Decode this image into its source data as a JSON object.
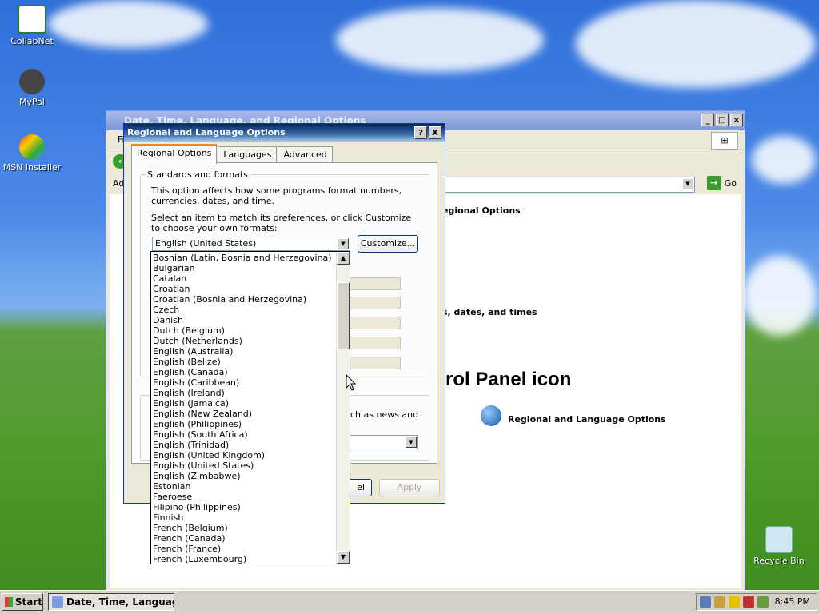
{
  "desktop": {
    "icons": [
      {
        "label": "CollabNet"
      },
      {
        "label": "MyPal"
      },
      {
        "label": "MSN Installer"
      },
      {
        "label": "Recycle Bin"
      }
    ]
  },
  "back_window": {
    "title": "Date, Time, Language, and Regional Options",
    "menu_first": "Fi",
    "address_label": "Ad",
    "go_label": "Go",
    "section_text_1": "egional Options",
    "section_text_2": "s, dates, and times",
    "big_heading": "rol Panel icon",
    "cp_icon_label": "Regional and Language Options"
  },
  "dialog": {
    "title": "Regional and Language Options",
    "help_btn": "?",
    "close_btn": "X",
    "tabs": [
      {
        "label": "Regional Options"
      },
      {
        "label": "Languages"
      },
      {
        "label": "Advanced"
      }
    ],
    "group_standards": "Standards and formats",
    "desc1": "This option affects how some programs format numbers, currencies, dates, and time.",
    "desc2": "Select an item to match its preferences, or click Customize to choose your own formats:",
    "selected_format": "English (United States)",
    "customize_btn": "Customize...",
    "location_partial": "uch as news and",
    "cancel_partial": "el",
    "apply_btn": "Apply"
  },
  "format_list": [
    "Bosnian (Latin, Bosnia and Herzegovina)",
    "Bulgarian",
    "Catalan",
    "Croatian",
    "Croatian (Bosnia and Herzegovina)",
    "Czech",
    "Danish",
    "Dutch (Belgium)",
    "Dutch (Netherlands)",
    "English (Australia)",
    "English (Belize)",
    "English (Canada)",
    "English (Caribbean)",
    "English (Ireland)",
    "English (Jamaica)",
    "English (New Zealand)",
    "English (Philippines)",
    "English (South Africa)",
    "English (Trinidad)",
    "English (United Kingdom)",
    "English (United States)",
    "English (Zimbabwe)",
    "Estonian",
    "Faeroese",
    "Filipino (Philippines)",
    "Finnish",
    "French (Belgium)",
    "French (Canada)",
    "French (France)",
    "French (Luxembourg)"
  ],
  "taskbar": {
    "start_label": "Start",
    "task_label": "Date, Time, Language...",
    "clock": "8:45 PM"
  },
  "colors": {
    "titlebar": "#0a246a",
    "accent_tab": "#e68b2c"
  }
}
